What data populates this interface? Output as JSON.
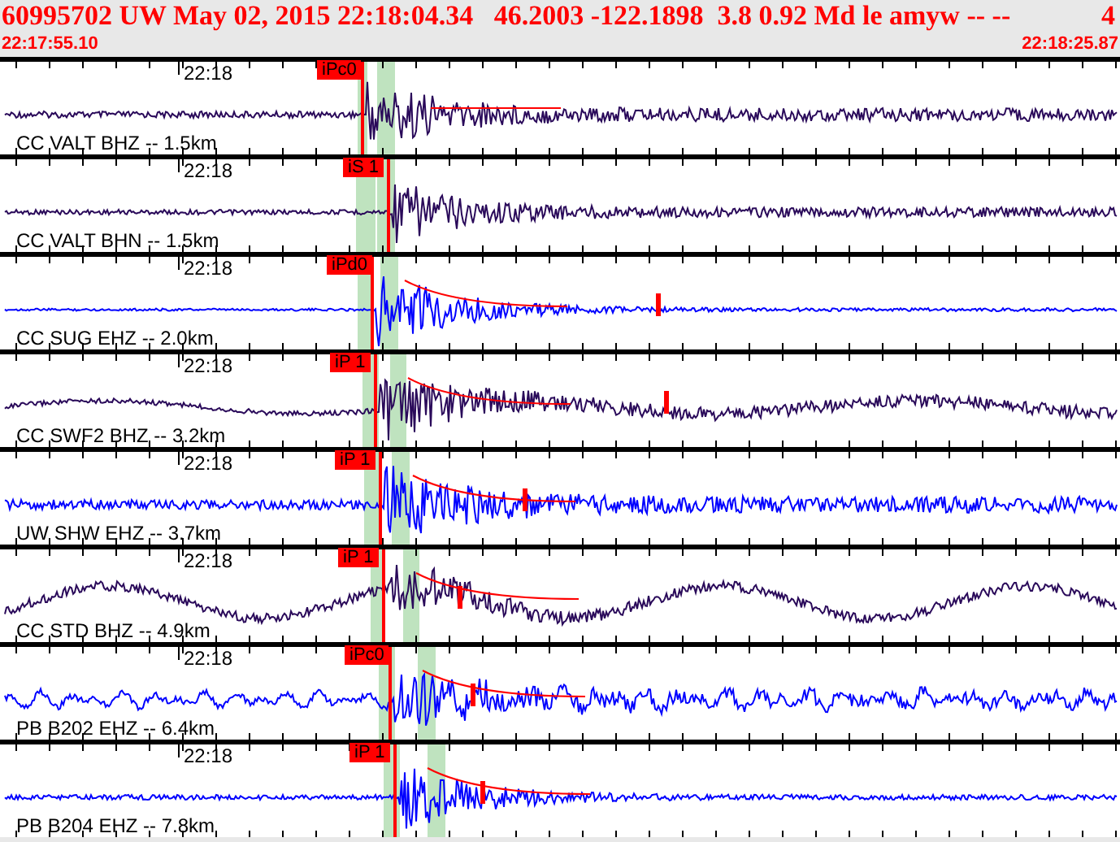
{
  "header": {
    "title": "60995702 UW May 02, 2015 22:18:04.34   46.2003 -122.1898  3.8 0.92 Md le amyw -- --",
    "count": "4",
    "start_time": "22:17:55.10",
    "end_time": "22:18:25.87"
  },
  "traces": [
    {
      "label": "CC VALT BHZ -- 1.5km",
      "time_mark": "22:18",
      "pick": "iPc0",
      "color": "#2a0a5a"
    },
    {
      "label": "CC VALT BHN -- 1.5km",
      "time_mark": "22:18",
      "pick": "iS 1",
      "color": "#2a0a5a"
    },
    {
      "label": "CC SUG EHZ -- 2.0km",
      "time_mark": "22:18",
      "pick": "iPd0",
      "color": "#0000ff"
    },
    {
      "label": "CC SWF2 BHZ -- 3.2km",
      "time_mark": "22:18",
      "pick": "iP 1",
      "color": "#2a0a5a"
    },
    {
      "label": "UW SHW EHZ -- 3.7km",
      "time_mark": "22:18",
      "pick": "iP 1",
      "color": "#0000ff"
    },
    {
      "label": "CC STD BHZ -- 4.9km",
      "time_mark": "22:18",
      "pick": "iP 1",
      "color": "#2a0a5a"
    },
    {
      "label": "PB B202 EHZ -- 6.4km",
      "time_mark": "22:18",
      "pick": "iPc0",
      "color": "#0000ff"
    },
    {
      "label": "PB B204 EHZ -- 7.8km",
      "time_mark": "22:18",
      "pick": "iP 1",
      "color": "#0000ff"
    }
  ]
}
